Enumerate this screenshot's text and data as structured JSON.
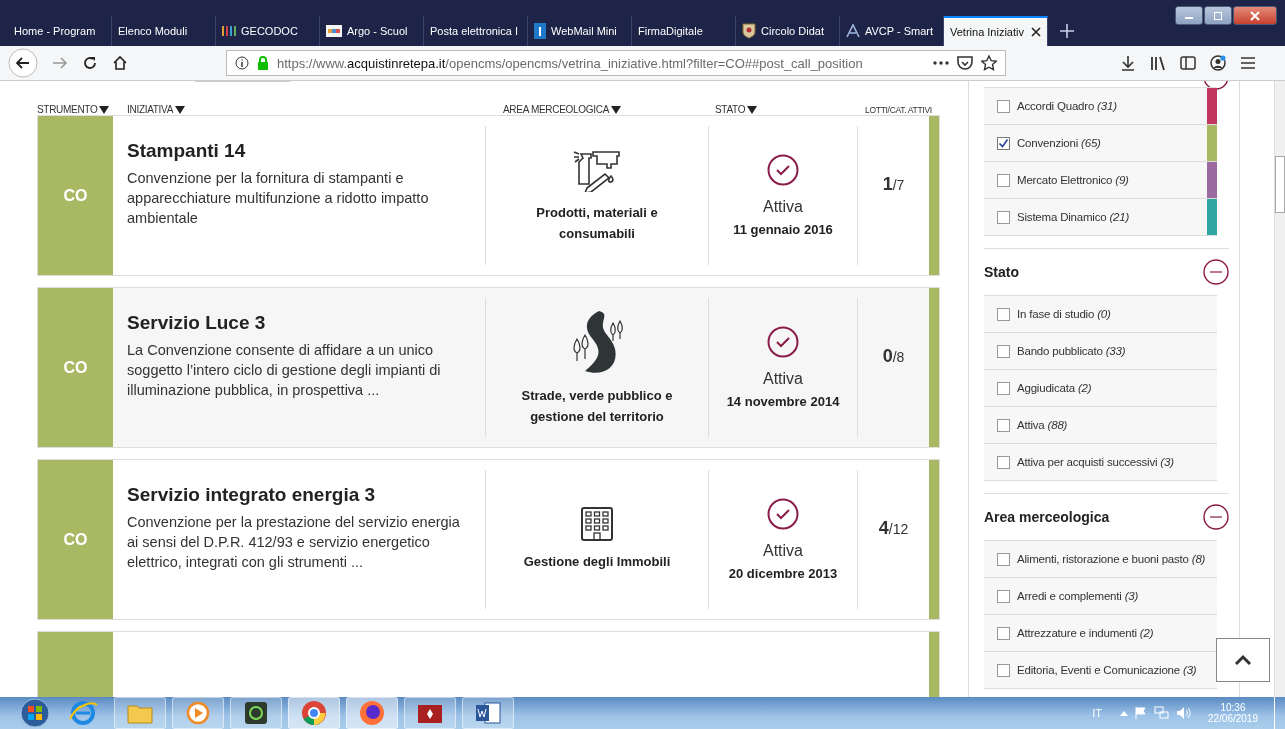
{
  "browser": {
    "tabs": [
      {
        "title": "Home - Program",
        "kind": "plain",
        "selected": false
      },
      {
        "title": "Elenco Moduli",
        "kind": "plain",
        "selected": false
      },
      {
        "title": "GECODOC",
        "kind": "bars",
        "selected": false
      },
      {
        "title": "Argo - Scuol",
        "kind": "swatch",
        "selected": false
      },
      {
        "title": "Posta elettronica I",
        "kind": "plain",
        "selected": false
      },
      {
        "title": "WebMail Mini",
        "kind": "blue",
        "selected": false
      },
      {
        "title": "FirmaDigitale",
        "kind": "plain",
        "selected": false
      },
      {
        "title": "Circolo Didat",
        "kind": "crest",
        "selected": false
      },
      {
        "title": "AVCP - Smart",
        "kind": "logo",
        "selected": false
      },
      {
        "title": "Vetrina Iniziativ",
        "kind": "plain",
        "selected": true
      }
    ],
    "url": {
      "scheme": "https://www.",
      "domain": "acquistinretepa.it",
      "path": "/opencms/opencms/vetrina_iniziative.html?filter=CO##post_call_position"
    }
  },
  "table": {
    "columns": [
      {
        "label": "STRUMENTO",
        "sortable": true
      },
      {
        "label": "INIZIATIVA",
        "sortable": true
      },
      {
        "label": "AREA MERCEOLOGICA",
        "sortable": true
      },
      {
        "label": "STATO",
        "sortable": true
      },
      {
        "label": "LOTTI/CAT. ATTIVI",
        "sortable": false
      }
    ],
    "rows": [
      {
        "instrument": "CO",
        "color": "#a9b963",
        "title": "Stampanti 14",
        "description": "Convenzione per la fornitura di stampanti e apparecchiature multifunzione a ridotto impatto ambientale",
        "area": "Prodotti, materiali e consumabili",
        "kind": "supplies",
        "status": "Attiva",
        "date": "11 gennaio 2016",
        "active_lots": "1",
        "total_lots": "/7"
      },
      {
        "instrument": "CO",
        "color": "#a9b963",
        "title": "Servizio Luce 3",
        "description": "La Convenzione consente di affidare a un unico soggetto l’intero ciclo di gestione degli impianti di illuminazione pubblica, in prospettiva ...",
        "area": "Strade, verde pubblico e gestione del territorio",
        "kind": "road",
        "status": "Attiva",
        "date": "14 novembre 2014",
        "active_lots": "0",
        "total_lots": "/8"
      },
      {
        "instrument": "CO",
        "color": "#a9b963",
        "title": "Servizio integrato energia 3",
        "description": "Convenzione per la prestazione del servizio energia ai sensi del D.P.R. 412/93 e servizio energetico elettrico, integrati con gli strumenti ...",
        "area": "Gestione degli Immobili",
        "kind": "building",
        "status": "Attiva",
        "date": "20 dicembre 2013",
        "active_lots": "4",
        "total_lots": "/12"
      }
    ]
  },
  "filters": [
    {
      "items": [
        {
          "label": "Accordi Quadro",
          "count": "(31)",
          "checked": false,
          "color": "#c2375f"
        },
        {
          "label": "Convenzioni",
          "count": "(65)",
          "checked": true,
          "color": "#a9b963"
        },
        {
          "label": "Mercato Elettronico",
          "count": "(9)",
          "checked": false,
          "color": "#9b6aa1"
        },
        {
          "label": "Sistema Dinamico",
          "count": "(21)",
          "checked": false,
          "color": "#2fa6a0"
        }
      ]
    },
    {
      "title": "Stato",
      "items": [
        {
          "label": "In fase di studio",
          "count": "(0)",
          "checked": false
        },
        {
          "label": "Bando pubblicato",
          "count": "(33)",
          "checked": false
        },
        {
          "label": "Aggiudicata",
          "count": "(2)",
          "checked": false
        },
        {
          "label": "Attiva",
          "count": "(88)",
          "checked": false
        },
        {
          "label": "Attiva per acquisti successivi",
          "count": "(3)",
          "checked": false
        }
      ]
    },
    {
      "title": "Area merceologica",
      "items": [
        {
          "label": "Alimenti, ristorazione e buoni pasto",
          "count": "(8)",
          "checked": false
        },
        {
          "label": "Arredi e complementi",
          "count": "(3)",
          "checked": false
        },
        {
          "label": "Attrezzature e indumenti",
          "count": "(2)",
          "checked": false
        },
        {
          "label": "Editoria, Eventi e Comunicazione",
          "count": "(3)",
          "checked": false
        }
      ]
    }
  ],
  "taskbar": {
    "language": "IT",
    "time": "10:36",
    "date": "22/06/2019"
  }
}
